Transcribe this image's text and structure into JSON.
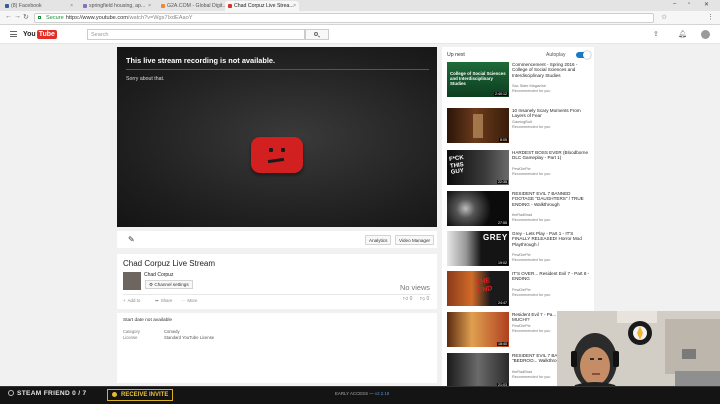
{
  "browser": {
    "tabs": [
      {
        "label": "(8) Facebook",
        "color": "#3b5998"
      },
      {
        "label": "springfield housing, ap...",
        "color": "#8a6fc0"
      },
      {
        "label": "G2A.COM - Global Digit...",
        "color": "#f0882f"
      },
      {
        "label": "Chad Corpuz Live Strea...",
        "color": "#e52d27"
      }
    ],
    "secure_label": "Secure",
    "url_host": "https://www.youtube.com",
    "url_path": "/watch?v=Wgs7IxdEAaoY"
  },
  "youtube": {
    "logo_you": "You",
    "logo_tube": "Tube",
    "search_placeholder": "Search",
    "brand_red": "#e52d27"
  },
  "player": {
    "error_title": "This live stream recording is not available.",
    "error_subtitle": "Sorry about that."
  },
  "actions": {
    "analytics": "Analytics",
    "video_manager": "Video Manager"
  },
  "video": {
    "title": "Chad Corpuz Live Stream",
    "channel": "Chad Corpuz",
    "channel_settings": "Channel settings",
    "views": "No views",
    "add_to": "Add to",
    "share": "Share",
    "more": "More",
    "likes": "0",
    "dislikes": "0"
  },
  "description": {
    "start_date": "Start date not available",
    "category_key": "Category",
    "category_value": "Comedy",
    "license_key": "License",
    "license_value": "Standard YouTube License"
  },
  "sidebar": {
    "up_next": "Up next",
    "autoplay": "Autoplay",
    "autoplay_on": true,
    "recs": [
      {
        "title": "Commencement - Spring 2016 - College of Social Sciences and Interdisciplinary Studies",
        "channel": "Sac State Magazine",
        "sub": "Recommended for you",
        "duration": "2:40:12",
        "thumb_text": "College of Social Sciences and Interdisciplinary Studies"
      },
      {
        "title": "10 Insanely Scary Moments From Layers of Fear",
        "channel": "GamingBolt",
        "sub": "Recommended for you",
        "duration": "8:05",
        "thumb_text": ""
      },
      {
        "title": "HARDEST BOSS EVER (Bloodborne DLC Gameplay - Part 1)",
        "channel": "PewDiePie",
        "sub": "Recommended for you",
        "duration": "22:35",
        "thumb_text": "F*CK THIS GUY"
      },
      {
        "title": "RESIDENT EVIL 7 BANNED FOOTAGE \"DAUGHTERS\" / TRUE ENDING - Walkthrough",
        "channel": "theRadBrad",
        "sub": "Recommended for you",
        "duration": "27:55",
        "thumb_text": ""
      },
      {
        "title": "Grey - Lets Play - Part 1 - IT'S FINALLY RELEASED! Horror Mod Playthrough /",
        "channel": "PewDiePie",
        "sub": "Recommended for you",
        "duration": "19:02",
        "thumb_text": "GREY"
      },
      {
        "title": "IT'S OVER... Resident Evil 7 - Part 8 - ENDING",
        "channel": "PewDiePie",
        "sub": "Recommended for you",
        "duration": "24:47",
        "thumb_text": "THE END"
      },
      {
        "title": "Resident Evil 7 - Pa... THIS TOO MUCH!?",
        "channel": "PewDiePie",
        "sub": "Recommended for you",
        "duration": "18:40",
        "thumb_text": ""
      },
      {
        "title": "RESIDENT EVIL 7 BA... FOOTAGE \"BEDROO... Walkthrough Gameplay",
        "channel": "theRadBrad",
        "sub": "Recommended for you",
        "duration": "21:03",
        "thumb_text": ""
      }
    ]
  },
  "gamebar": {
    "steam_friend": "STEAM FRIEND 0 / 7",
    "receive_invite": "RECEIVE INVITE",
    "early_access": "EARLY ACCESS",
    "version": "v2.2.18"
  }
}
